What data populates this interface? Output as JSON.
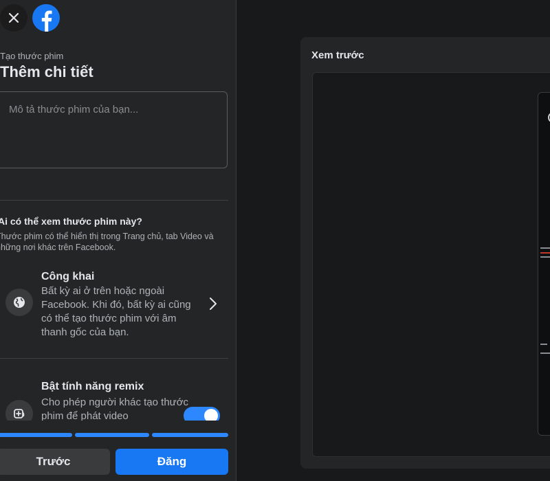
{
  "header": {
    "close_icon": "close-icon",
    "logo": "facebook-logo",
    "brand_color": "#1877f2"
  },
  "form": {
    "subtitle": "Tạo thước phim",
    "title": "Thêm chi tiết",
    "description_placeholder": "Mô tả thước phim của bạn...",
    "description_value": ""
  },
  "audience": {
    "heading": "Ai có thể xem thước phim này?",
    "description": "Thước phim có thể hiển thị trong Trang chủ, tab Video và những nơi khác trên Facebook.",
    "option": {
      "icon": "globe-icon",
      "title": "Công khai",
      "description": "Bất kỳ ai ở trên hoặc ngoài Facebook. Khi đó, bất kỳ ai cũng có thể tạo thước phim với âm thanh gốc của bạn."
    }
  },
  "remix": {
    "icon": "remix-icon",
    "title": "Bật tính năng remix",
    "description": "Cho phép người khác tạo thước phim để phát video",
    "enabled": true
  },
  "progress": {
    "steps_total": 3,
    "steps_completed": 3,
    "color": "#2d88ff"
  },
  "actions": {
    "prev_label": "Trước",
    "post_label": "Đăng"
  },
  "preview": {
    "title": "Xem trước"
  }
}
